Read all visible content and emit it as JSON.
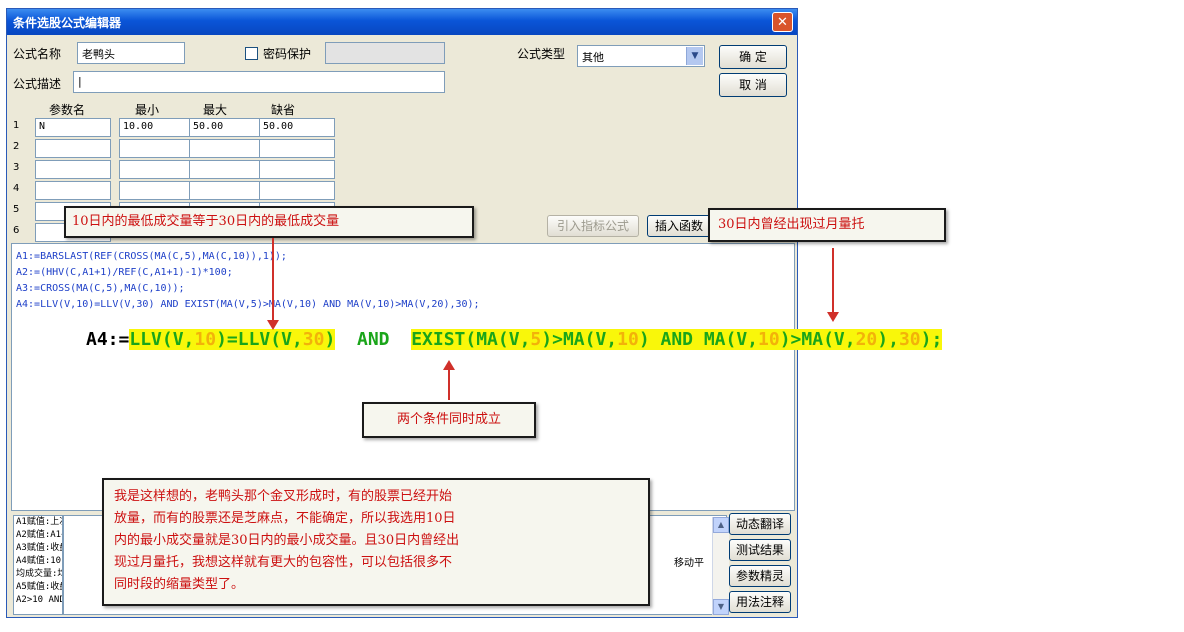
{
  "window": {
    "title": "条件选股公式编辑器",
    "close_label": "✕"
  },
  "form": {
    "name_label": "公式名称",
    "name_value": "老鸭头",
    "password_label": "密码保护",
    "type_label": "公式类型",
    "type_value": "其他",
    "desc_label": "公式描述",
    "desc_value": "|",
    "ok_label": "确  定",
    "cancel_label": "取  消"
  },
  "params": {
    "headers": [
      "参数名",
      "最小",
      "最大",
      "缺省"
    ],
    "row_numbers": [
      "1",
      "2",
      "3",
      "4",
      "5",
      "6"
    ],
    "rows": [
      [
        "N",
        "10.00",
        "50.00",
        "50.00"
      ],
      [
        "",
        "",
        "",
        ""
      ],
      [
        "",
        "",
        "",
        ""
      ],
      [
        "",
        "",
        "",
        ""
      ],
      [
        "",
        "",
        "",
        ""
      ],
      [
        "",
        "",
        "",
        ""
      ]
    ]
  },
  "buttons": {
    "import_indicator": "引入指标公式",
    "insert_function": "插入函数"
  },
  "code_lines": [
    "A1:=BARSLAST(REF(CROSS(MA(C,5),MA(C,10)),1));",
    "A2:=(HHV(C,A1+1)/REF(C,A1+1)-1)*100;",
    "A3:=CROSS(MA(C,5),MA(C,10));",
    "A4:=LLV(V,10)=LLV(V,30) AND EXIST(MA(V,5)>MA(V,10) AND MA(V,10)>MA(V,20),30);"
  ],
  "big_code": {
    "prefix": "A4:=",
    "part1": "LLV(V,",
    "n1": "10",
    "part2": ")=LLV(V,",
    "n2": "30",
    "part3": ")",
    "and1": "AND",
    "part4": "EXIST(MA(V,",
    "n3": "5",
    "part5": ")>MA(V,",
    "n4": "10",
    "part6": ") AND MA(V,",
    "n5": "10",
    "part7": ")>MA(V,",
    "n6": "20",
    "part8": "),",
    "n7": "30",
    "part9": ");"
  },
  "bottom_list": [
    "A1赋值:上次均",
    "A2赋值:A1+1",
    "A3赋值:收盘价",
    "A4赋值:10日内",
    "均成交量:均",
    "A5赋值:收盘价",
    "A2>10 AND A2"
  ],
  "bottom_partial_text": "移动平",
  "side_buttons": [
    "动态翻译",
    "测试结果",
    "参数精灵",
    "用法注释"
  ],
  "callouts": {
    "c1": "10日内的最低成交量等于30日内的最低成交量",
    "c2": "30日内曾经出现过月量托",
    "c3": "两个条件同时成立",
    "c4_lines": [
      "我是这样想的，老鸭头那个金叉形成时，有的股票已经开始",
      "放量，而有的股票还是芝麻点，不能确定，所以我选用10日",
      "内的最小成交量就是30日内的最小成交量。且30日内曾经出",
      "现过月量托，我想这样就有更大的包容性，可以包括很多不",
      "同时段的缩量类型了。"
    ]
  },
  "colors": {
    "highlight": "#f9f70a",
    "callout_text": "#cc1010",
    "arrow": "#d0302a",
    "title_bar": "#0a55d8"
  }
}
